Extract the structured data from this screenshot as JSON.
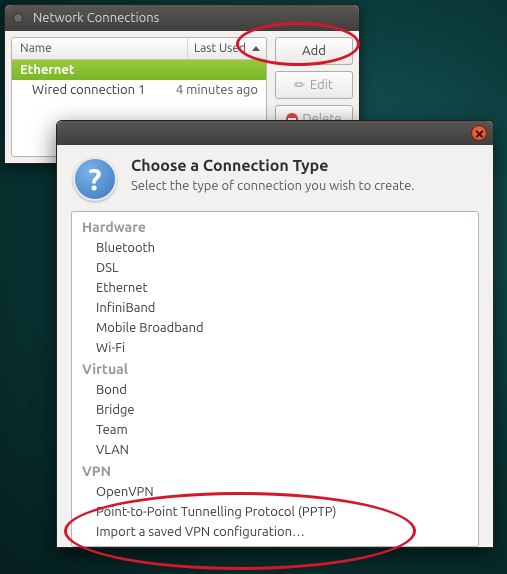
{
  "win1": {
    "title": "Network Connections",
    "columns": {
      "name": "Name",
      "last": "Last Used"
    },
    "category": "Ethernet",
    "conn": {
      "name": "Wired connection 1",
      "last": "4 minutes ago"
    },
    "buttons": {
      "add": "Add",
      "edit": "Edit",
      "delete": "Delete"
    }
  },
  "dlg": {
    "title": "Choose a Connection Type",
    "subtitle": "Select the type of connection you wish to create.",
    "groups": [
      {
        "label": "Hardware",
        "items": [
          "Bluetooth",
          "DSL",
          "Ethernet",
          "InfiniBand",
          "Mobile Broadband",
          "Wi-Fi"
        ]
      },
      {
        "label": "Virtual",
        "items": [
          "Bond",
          "Bridge",
          "Team",
          "VLAN"
        ]
      },
      {
        "label": "VPN",
        "items": [
          "OpenVPN",
          "Point-to-Point Tunnelling Protocol (PPTP)",
          "Import a saved VPN configuration…"
        ]
      }
    ]
  }
}
